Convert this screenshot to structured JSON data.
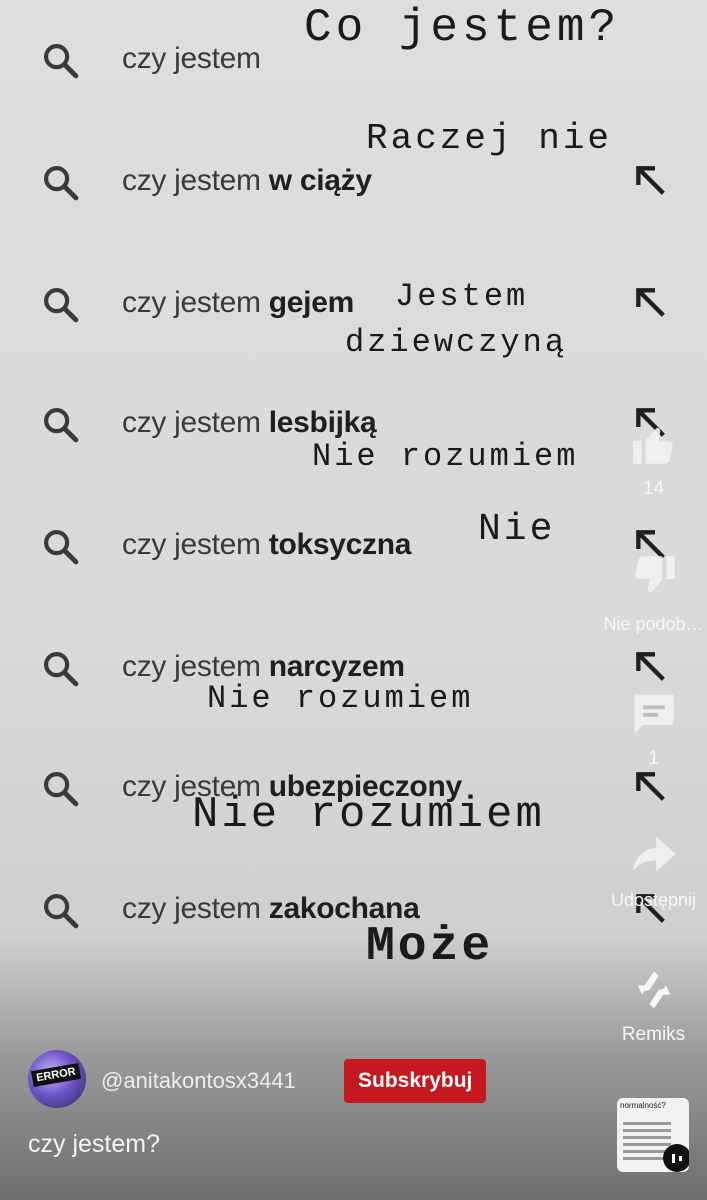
{
  "suggestions": [
    {
      "prefix": "czy jestem",
      "bold": "",
      "has_arrow": false
    },
    {
      "prefix": "czy jestem",
      "bold": "w ciąży",
      "has_arrow": true
    },
    {
      "prefix": "czy jestem",
      "bold": "gejem",
      "has_arrow": true
    },
    {
      "prefix": "czy jestem",
      "bold": "lesbijką",
      "has_arrow": true
    },
    {
      "prefix": "czy jestem",
      "bold": "toksyczna",
      "has_arrow": true
    },
    {
      "prefix": "czy jestem",
      "bold": "narcyzem",
      "has_arrow": true
    },
    {
      "prefix": "czy jestem",
      "bold": "ubezpieczony",
      "has_arrow": true
    },
    {
      "prefix": "czy jestem",
      "bold": "zakochana",
      "has_arrow": true
    }
  ],
  "overlay_texts": [
    "Co jestem?",
    "Raczej nie",
    "Jestem",
    "dziewczyną",
    "Nie rozumiem",
    "Nie",
    "Nie rozumiem",
    "Nie rozumiem",
    "Może"
  ],
  "actions": {
    "like_count": "14",
    "dislike_label": "Nie podob…",
    "comments_count": "1",
    "share_label": "Udostępnij",
    "remix_label": "Remiks"
  },
  "channel": {
    "avatar_text": "ERROR",
    "handle": "@anitakontosx3441",
    "subscribe_label": "Subskrybuj"
  },
  "caption": "czy jestem?",
  "thumbnail": {
    "title": "normalność?"
  },
  "colors": {
    "subscribe": "#c4191f",
    "icon": "#3a3a3a",
    "overlay_text": "#1a1a1a"
  }
}
